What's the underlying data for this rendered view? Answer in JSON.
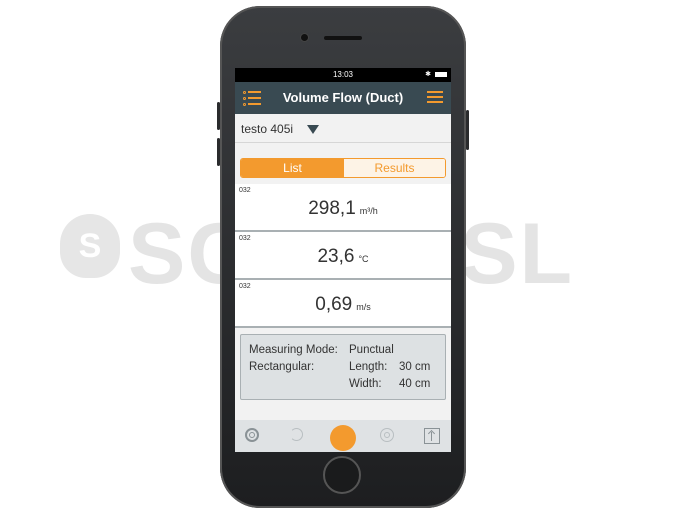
{
  "watermark": {
    "text": "SCHIESSL",
    "logo_letter": "S"
  },
  "status_bar": {
    "time": "13:03",
    "bluetooth": "✱"
  },
  "app_bar": {
    "title": "Volume Flow (Duct)"
  },
  "device": {
    "name": "testo 405i"
  },
  "tabs": [
    {
      "label": "List",
      "active": true
    },
    {
      "label": "Results",
      "active": false
    }
  ],
  "readings": [
    {
      "channel": "032",
      "value": "298,1",
      "unit": "m³/h"
    },
    {
      "channel": "032",
      "value": "23,6",
      "unit": "°C"
    },
    {
      "channel": "032",
      "value": "0,69",
      "unit": "m/s"
    }
  ],
  "info": {
    "measuring_mode_label": "Measuring Mode:",
    "measuring_mode_value": "Punctual",
    "shape_label": "Rectangular:",
    "length_label": "Length:",
    "length_value": "30 cm",
    "width_label": "Width:",
    "width_value": "40 cm"
  },
  "colors": {
    "accent": "#f39a2e",
    "header": "#394a52"
  },
  "toolbar_icons": [
    "settings-icon",
    "undo-icon",
    "record-button",
    "target-icon",
    "export-icon"
  ]
}
